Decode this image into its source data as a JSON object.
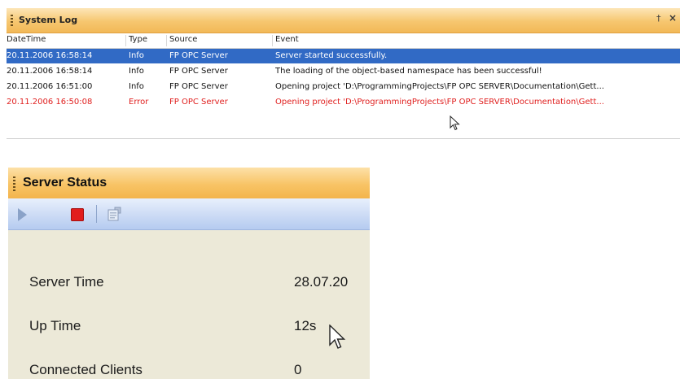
{
  "system_log": {
    "title": "System Log",
    "pin_glyph": "†",
    "close_glyph": "×",
    "columns": [
      "DateTime",
      "Type",
      "Source",
      "Event"
    ],
    "rows": [
      {
        "datetime": "20.11.2006 16:58:14",
        "type": "Info",
        "source": "FP OPC Server",
        "event": "Server started successfully."
      },
      {
        "datetime": "20.11.2006 16:58:14",
        "type": "Info",
        "source": "FP OPC Server",
        "event": "The loading of the object-based namespace has been successful!"
      },
      {
        "datetime": "20.11.2006 16:51:00",
        "type": "Info",
        "source": "FP OPC Server",
        "event": "Opening project 'D:\\ProgrammingProjects\\FP OPC SERVER\\Documentation\\Gett..."
      },
      {
        "datetime": "20.11.2006 16:50:08",
        "type": "Error",
        "source": "FP OPC Server",
        "event": "Opening project 'D:\\ProgrammingProjects\\FP OPC SERVER\\Documentation\\Gett..."
      }
    ],
    "selected_row": 0,
    "error_color": "#e0201f",
    "selection_color": "#316ac5"
  },
  "server_status": {
    "title": "Server Status",
    "toolbar": {
      "buttons": [
        "play-icon",
        "stop-icon",
        "properties-icon"
      ]
    },
    "rows": [
      {
        "label": "Server Time",
        "value": "28.07.20"
      },
      {
        "label": "Up Time",
        "value": "12s"
      },
      {
        "label": "Connected Clients",
        "value": "0"
      }
    ],
    "title_bar_color": "#f6c66f",
    "toolbar_color": "#c9d9f4"
  }
}
